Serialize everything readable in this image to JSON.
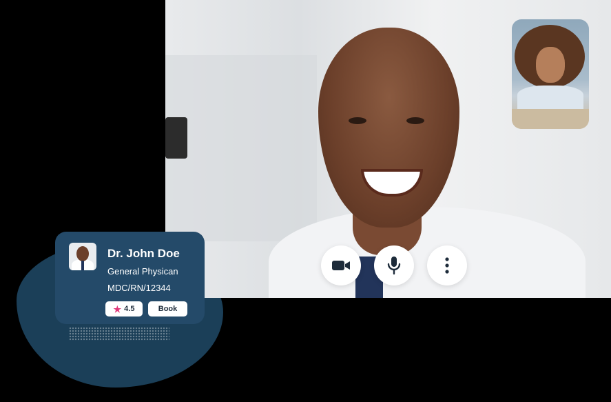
{
  "call": {
    "controls": [
      {
        "name": "camera-icon"
      },
      {
        "name": "microphone-icon"
      },
      {
        "name": "more-options-icon"
      }
    ]
  },
  "doctor_card": {
    "name": "Dr. John Doe",
    "specialty": "General Physican",
    "registration": "MDC/RN/12344",
    "rating": "4.5",
    "rating_icon": "star-icon",
    "book_label": "Book"
  },
  "colors": {
    "card_bg": "#244a69",
    "blob_bg": "#1b3f58",
    "accent_star": "#e0377a",
    "icon_dark": "#1d2b3a"
  }
}
